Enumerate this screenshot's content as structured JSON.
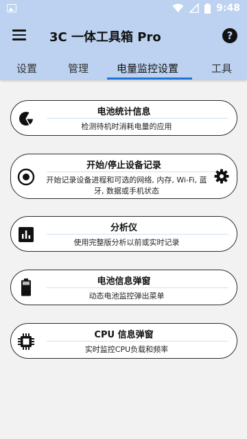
{
  "status_bar": {
    "time": "9:48"
  },
  "app_bar": {
    "title": "3C 一体工具箱 Pro"
  },
  "tabs": [
    {
      "label": "设置"
    },
    {
      "label": "管理"
    },
    {
      "label": "电量监控设置",
      "active": true
    },
    {
      "label": "工具"
    }
  ],
  "cards": [
    {
      "title": "电池统计信息",
      "desc": "检测待机时消耗电量的应用",
      "icon": "pie-chart-icon"
    },
    {
      "title": "开始/停止设备记录",
      "desc": "开始记录设备进程和可选的网络, 内存, Wi-Fi, 蓝牙, 数据或手机状态",
      "icon": "record-icon",
      "action_icon": "gear-icon"
    },
    {
      "title": "分析仪",
      "desc": "使用完整版分析以前或实时记录",
      "icon": "bar-chart-icon"
    },
    {
      "title": "电池信息弹窗",
      "desc": "动态电池监控弹出菜单",
      "icon": "battery-icon"
    },
    {
      "title": "CPU 信息弹窗",
      "desc": "实时监控CPU负载和频率",
      "icon": "cpu-chip-icon"
    }
  ]
}
